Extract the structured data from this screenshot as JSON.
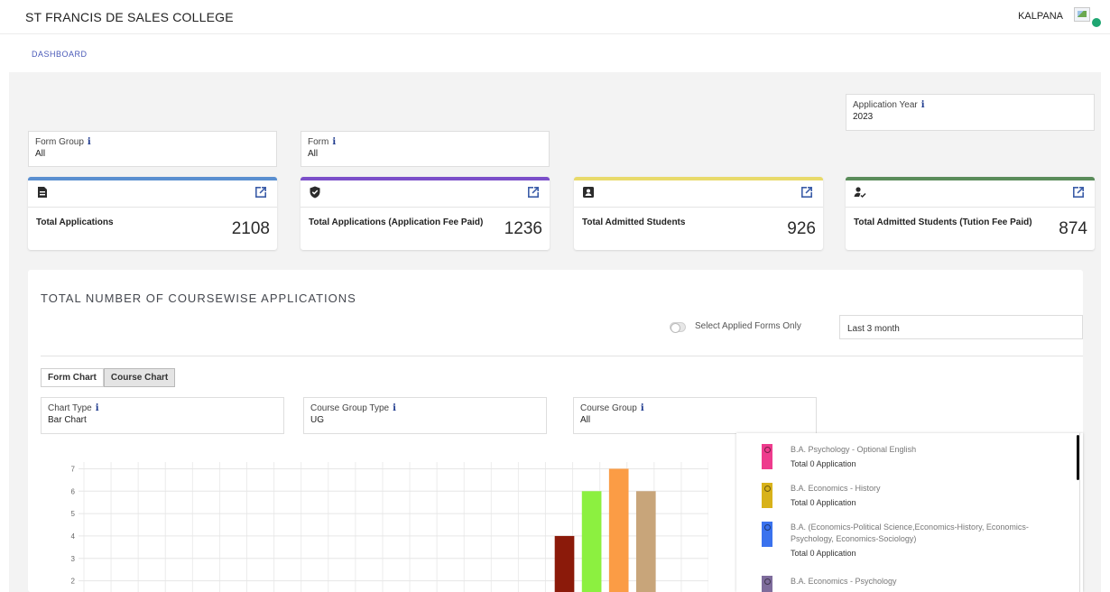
{
  "header": {
    "brand": "ST FRANCIS DE SALES COLLEGE",
    "user_name": "KALPANA"
  },
  "breadcrumb": {
    "current": "DASHBOARD"
  },
  "filters": {
    "application_year": {
      "label": "Application Year",
      "value": "2023"
    },
    "form_group": {
      "label": "Form Group",
      "value": "All"
    },
    "form": {
      "label": "Form",
      "value": "All"
    }
  },
  "stats": [
    {
      "title": "Total Applications",
      "value": "2108",
      "color": "#5a8fd0",
      "icon": "document-icon"
    },
    {
      "title": "Total Applications (Application Fee Paid)",
      "value": "1236",
      "color": "#7b4fc9",
      "icon": "shield-check-icon"
    },
    {
      "title": "Total Admitted Students",
      "value": "926",
      "color": "#e8da6a",
      "icon": "id-card-icon"
    },
    {
      "title": "Total Admitted Students (Tution Fee Paid)",
      "value": "874",
      "color": "#5a8c5a",
      "icon": "user-check-icon"
    }
  ],
  "panel": {
    "title": "TOTAL NUMBER OF COURSEWISE APPLICATIONS",
    "toggle_label": "Select Applied Forms Only",
    "range_value": "Last 3 month",
    "tabs": [
      "Form Chart",
      "Course Chart"
    ],
    "active_tab": "Course Chart",
    "chart_type": {
      "label": "Chart Type",
      "value": "Bar Chart"
    },
    "course_group_type": {
      "label": "Course Group Type",
      "value": "UG"
    },
    "course_group": {
      "label": "Course Group",
      "value": "All"
    }
  },
  "chart_data": {
    "type": "bar",
    "y_ticks": [
      2,
      3,
      4,
      5,
      6,
      7
    ],
    "ylim": [
      1.5,
      7.3
    ],
    "slots": 23,
    "bars": [
      {
        "slot": 17,
        "value": 4,
        "color": "#8b1a0a"
      },
      {
        "slot": 18,
        "value": 6,
        "color": "#8cf040"
      },
      {
        "slot": 19,
        "value": 7,
        "color": "#fb9c45"
      },
      {
        "slot": 20,
        "value": 6,
        "color": "#c8a57a"
      }
    ]
  },
  "legend": [
    {
      "name": "B.A. Psychology - Optional English",
      "sub": "Total 0 Application",
      "color": "#ee3b8d"
    },
    {
      "name": "B.A. Economics - History",
      "sub": "Total 0 Application",
      "color": "#d8b21a"
    },
    {
      "name": "B.A. (Economics-Political Science,Economics-History, Economics-Psychology, Economics-Sociology)",
      "sub": "Total 0 Application",
      "color": "#3a72ee"
    },
    {
      "name": "B.A. Economics - Psychology",
      "sub": "",
      "color": "#7e6c9c"
    }
  ]
}
